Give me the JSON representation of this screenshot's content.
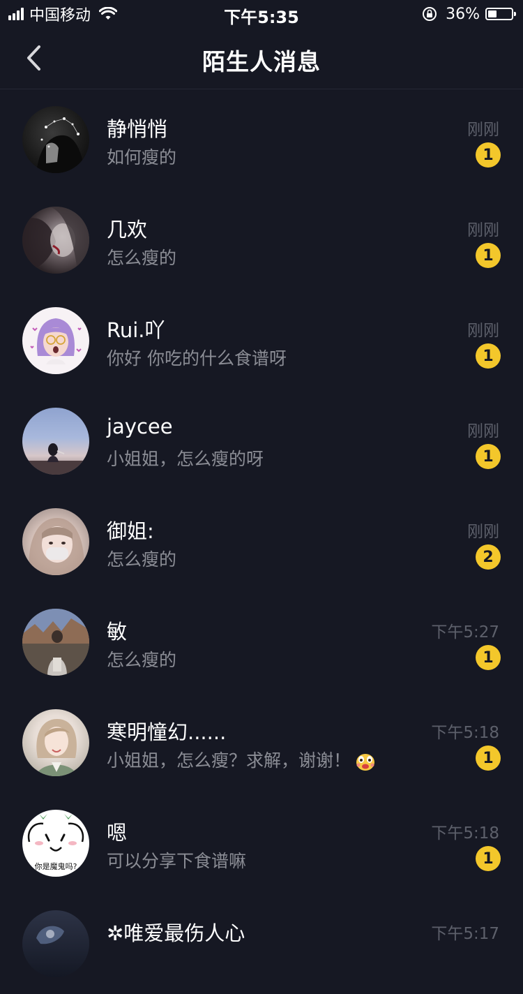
{
  "status_bar": {
    "carrier": "中国移动",
    "time": "下午5:35",
    "battery_percent_text": "36%",
    "battery_level": 0.36
  },
  "nav": {
    "title": "陌生人消息",
    "back_icon": "chevron-left-icon"
  },
  "colors": {
    "background": "#161823",
    "badge": "#f3c72b",
    "preview_text": "#8b8d95",
    "time_text": "#5d606b"
  },
  "messages": [
    {
      "name": "静悄悄",
      "preview": "如何瘦的",
      "time": "刚刚",
      "unread": "1"
    },
    {
      "name": "几欢",
      "preview": "怎么瘦的",
      "time": "刚刚",
      "unread": "1"
    },
    {
      "name": "Rui.吖",
      "preview": "你好 你吃的什么食谱呀",
      "time": "刚刚",
      "unread": "1"
    },
    {
      "name": "jaycee",
      "preview": "小姐姐，怎么瘦的呀",
      "time": "刚刚",
      "unread": "1"
    },
    {
      "name": "御姐:",
      "preview": "怎么瘦的",
      "time": "刚刚",
      "unread": "2"
    },
    {
      "name": "敏",
      "preview": "怎么瘦的",
      "time": "下午5:27",
      "unread": "1"
    },
    {
      "name": "寒明憧幻......",
      "preview": "小姐姐，怎么瘦？求解，谢谢！",
      "time": "下午5:18",
      "unread": "1"
    },
    {
      "name": "嗯",
      "preview": "可以分享下食谱嘛",
      "time": "下午5:18",
      "unread": "1",
      "avatar_text": "你是魔鬼吗?"
    },
    {
      "name": "✲唯爱最伤人心",
      "preview": "",
      "time": "下午5:17",
      "unread": ""
    }
  ]
}
